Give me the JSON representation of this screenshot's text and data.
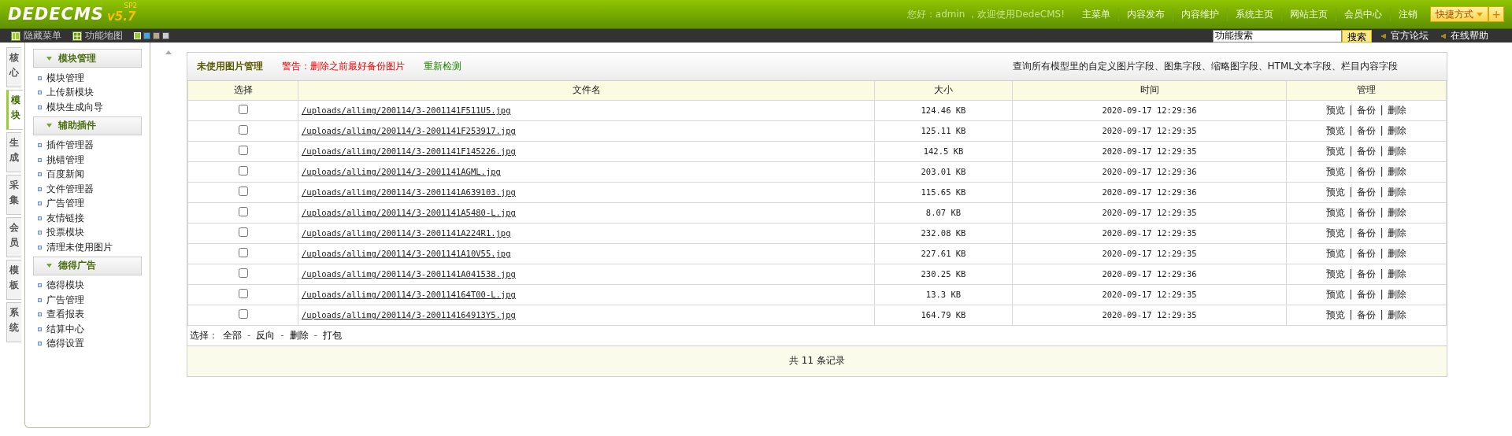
{
  "logo": {
    "name": "DEDECMS",
    "version": "v5.7",
    "edition": "SP2"
  },
  "greeting": "您好：admin ，欢迎使用DedeCMS!",
  "top_menu": [
    "主菜单",
    "内容发布",
    "内容维护",
    "系统主页",
    "网站主页",
    "会员中心",
    "注销"
  ],
  "shortcut": {
    "label": "快捷方式",
    "add": "+"
  },
  "toolbar": {
    "hide_menu": "隐藏菜单",
    "function_map": "功能地图"
  },
  "skins": [
    {
      "color": "#9acd32",
      "selected": true
    },
    {
      "color": "#3fa9e0",
      "selected": false
    },
    {
      "color": "#b8a88a",
      "selected": false
    },
    {
      "color": "#c8ccd0",
      "selected": false
    }
  ],
  "search": {
    "value": "功能搜索",
    "button": "搜索"
  },
  "help_links": [
    "官方论坛",
    "在线帮助"
  ],
  "side_tabs": [
    {
      "label": "核心",
      "selected": false
    },
    {
      "label": "模块",
      "selected": true
    },
    {
      "label": "生成",
      "selected": false
    },
    {
      "label": "采集",
      "selected": false
    },
    {
      "label": "会员",
      "selected": false
    },
    {
      "label": "模板",
      "selected": false
    },
    {
      "label": "系统",
      "selected": false
    }
  ],
  "sidebar": [
    {
      "title": "模块管理",
      "expanded": true,
      "items": [
        "模块管理",
        "上传新模块",
        "模块生成向导"
      ]
    },
    {
      "title": "辅助插件",
      "expanded": true,
      "items": [
        "插件管理器",
        "挑错管理",
        "百度新闻",
        "文件管理器",
        "广告管理",
        "友情链接",
        "投票模块",
        "清理未使用图片"
      ]
    },
    {
      "title": "德得广告",
      "expanded": true,
      "items": [
        "德得模块",
        "广告管理",
        "查看报表",
        "结算中心",
        "德得设置"
      ]
    }
  ],
  "panel": {
    "title": "未使用图片管理",
    "warning": "警告：删除之前最好备份图片",
    "recheck": "重新检测",
    "note": "查询所有模型里的自定义图片字段、图集字段、缩略图字段、HTML文本字段、栏目内容字段"
  },
  "table": {
    "columns": [
      "选择",
      "文件名",
      "大小",
      "时间",
      "管理"
    ],
    "rows": [
      {
        "checked": false,
        "file": "/uploads/allimg/200114/3-2001141F511U5.jpg",
        "size": "124.46 KB",
        "time": "2020-09-17 12:29:36"
      },
      {
        "checked": false,
        "file": "/uploads/allimg/200114/3-2001141F253917.jpg",
        "size": "125.11 KB",
        "time": "2020-09-17 12:29:35"
      },
      {
        "checked": false,
        "file": "/uploads/allimg/200114/3-2001141F145226.jpg",
        "size": "142.5 KB",
        "time": "2020-09-17 12:29:35"
      },
      {
        "checked": false,
        "file": "/uploads/allimg/200114/3-2001141AGML.jpg",
        "size": "203.01 KB",
        "time": "2020-09-17 12:29:36"
      },
      {
        "checked": false,
        "file": "/uploads/allimg/200114/3-2001141A639103.jpg",
        "size": "115.65 KB",
        "time": "2020-09-17 12:29:36"
      },
      {
        "checked": false,
        "file": "/uploads/allimg/200114/3-2001141A5480-L.jpg",
        "size": "8.07 KB",
        "time": "2020-09-17 12:29:35"
      },
      {
        "checked": false,
        "file": "/uploads/allimg/200114/3-2001141A224R1.jpg",
        "size": "232.08 KB",
        "time": "2020-09-17 12:29:35"
      },
      {
        "checked": false,
        "file": "/uploads/allimg/200114/3-2001141A10V55.jpg",
        "size": "227.61 KB",
        "time": "2020-09-17 12:29:35"
      },
      {
        "checked": false,
        "file": "/uploads/allimg/200114/3-2001141A041538.jpg",
        "size": "230.25 KB",
        "time": "2020-09-17 12:29:36"
      },
      {
        "checked": false,
        "file": "/uploads/allimg/200114/3-200114164T00-L.jpg",
        "size": "13.3 KB",
        "time": "2020-09-17 12:29:35"
      },
      {
        "checked": false,
        "file": "/uploads/allimg/200114/3-200114164913Y5.jpg",
        "size": "164.79 KB",
        "time": "2020-09-17 12:29:35"
      }
    ],
    "manage": [
      [
        {
          "kind": "link",
          "text": "预览"
        },
        {
          "kind": "separator",
          "text": "|"
        },
        {
          "kind": "link",
          "text": "备份"
        },
        {
          "kind": "separator",
          "text": "|"
        },
        {
          "kind": "link",
          "text": "删除"
        }
      ],
      [
        {
          "kind": "link",
          "text": "预览"
        },
        {
          "kind": "separator",
          "text": "|"
        },
        {
          "kind": "link",
          "text": "备份"
        },
        {
          "kind": "separator",
          "text": "|"
        },
        {
          "kind": "link",
          "text": "删除"
        }
      ],
      [
        {
          "kind": "link",
          "text": "预览"
        },
        {
          "kind": "separator",
          "text": "|"
        },
        {
          "kind": "link",
          "text": "备份"
        },
        {
          "kind": "separator",
          "text": "|"
        },
        {
          "kind": "link",
          "text": "删除"
        }
      ],
      [
        {
          "kind": "link",
          "text": "预览"
        },
        {
          "kind": "separator",
          "text": "|"
        },
        {
          "kind": "link",
          "text": "备份"
        },
        {
          "kind": "separator",
          "text": "|"
        },
        {
          "kind": "link",
          "text": "删除"
        }
      ],
      [
        {
          "kind": "link",
          "text": "预览"
        },
        {
          "kind": "separator",
          "text": "|"
        },
        {
          "kind": "link",
          "text": "备份"
        },
        {
          "kind": "separator",
          "text": "|"
        },
        {
          "kind": "link",
          "text": "删除"
        }
      ],
      [
        {
          "kind": "link",
          "text": "预览"
        },
        {
          "kind": "separator",
          "text": "|"
        },
        {
          "kind": "link",
          "text": "备份"
        },
        {
          "kind": "separator",
          "text": "|"
        },
        {
          "kind": "link",
          "text": "删除"
        }
      ],
      [
        {
          "kind": "link",
          "text": "预览"
        },
        {
          "kind": "separator",
          "text": "|"
        },
        {
          "kind": "link",
          "text": "备份"
        },
        {
          "kind": "separator",
          "text": "|"
        },
        {
          "kind": "link",
          "text": "删除"
        }
      ],
      [
        {
          "kind": "link",
          "text": "预览"
        },
        {
          "kind": "separator",
          "text": "|"
        },
        {
          "kind": "link",
          "text": "备份"
        },
        {
          "kind": "separator",
          "text": "|"
        },
        {
          "kind": "link",
          "text": "删除"
        }
      ],
      [
        {
          "kind": "link",
          "text": "预览"
        },
        {
          "kind": "separator",
          "text": "|"
        },
        {
          "kind": "link",
          "text": "备份"
        },
        {
          "kind": "separator",
          "text": "|"
        },
        {
          "kind": "link",
          "text": "删除"
        }
      ],
      [
        {
          "kind": "link",
          "text": "预览"
        },
        {
          "kind": "separator",
          "text": "|"
        },
        {
          "kind": "link",
          "text": "备份"
        },
        {
          "kind": "separator",
          "text": "|"
        },
        {
          "kind": "link",
          "text": "删除"
        }
      ],
      [
        {
          "kind": "link",
          "text": "预览"
        },
        {
          "kind": "separator",
          "text": "|"
        },
        {
          "kind": "link",
          "text": "备份"
        },
        {
          "kind": "separator",
          "text": "|"
        },
        {
          "kind": "link",
          "text": "删除"
        }
      ]
    ]
  },
  "select_bar": {
    "label": "选择：",
    "items": [
      {
        "kind": "link",
        "text": "全部"
      },
      {
        "kind": "separator",
        "text": "-"
      },
      {
        "kind": "link",
        "text": "反向"
      },
      {
        "kind": "separator",
        "text": "-"
      },
      {
        "kind": "link",
        "text": "删除"
      },
      {
        "kind": "separator",
        "text": "-"
      },
      {
        "kind": "link",
        "text": "打包"
      }
    ]
  },
  "total": "共 11 条记录"
}
